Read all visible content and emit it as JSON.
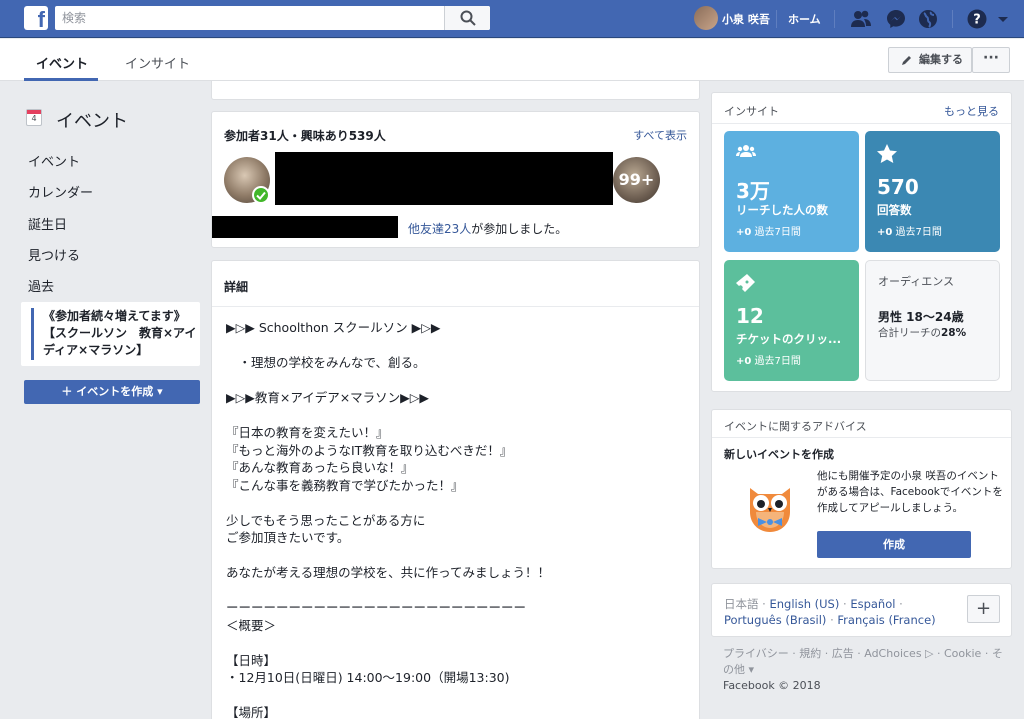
{
  "topbar": {
    "logo": "f",
    "search_placeholder": "検索",
    "user_name": "小泉 咲吾",
    "home": "ホーム",
    "icons": [
      "friends-icon",
      "messenger-icon",
      "globe-icon",
      "help-icon",
      "caret-down-icon"
    ]
  },
  "subnav": {
    "tabs": [
      {
        "label": "イベント",
        "active": true
      },
      {
        "label": "インサイト",
        "active": false
      }
    ],
    "edit_label": "編集する",
    "more_label": "···"
  },
  "left": {
    "calendar_day": "4",
    "title": "イベント",
    "items": [
      "イベント",
      "カレンダー",
      "誕生日",
      "見つける",
      "過去"
    ],
    "promo": "《参加者続々増えてます》【スクールソン　教育×アイディア×マラソン】",
    "create_button": "＋ イベントを作成 ▾"
  },
  "attendance": {
    "title": "参加者31人・興味あり539人",
    "see_all": "すべて表示",
    "more_count": "99+",
    "friends_link": "他友達23人",
    "friends_suffix": "が参加しました。"
  },
  "detail": {
    "title": "詳細",
    "body": "▶▷▶ Schoolthon スクールソン ▶▷▶\n\n　・理想の学校をみんなで、創る。\n\n▶▷▶教育×アイデア×マラソン▶▷▶\n\n『日本の教育を変えたい！』\n『もっと海外のようなIT教育を取り込むべきだ！』\n『あんな教育あったら良いな！』\n『こんな事を義務教育で学びたかった！』\n\n少しでもそう思ったことがある方に\nご参加頂きたいです。\n\nあなたが考える理想の学校を、共に作ってみましょう！！\n\nーーーーーーーーーーーーーーーーーーーーーーーー\n＜概要＞\n\n【日時】\n・12月10日(日曜日) 14:00〜19:00（開場13:30)\n\n【場所】"
  },
  "insights": {
    "header": "インサイト",
    "see_more": "もっと見る",
    "tiles": [
      {
        "value": "3万",
        "label": "リーチした人の数",
        "delta": "+0",
        "period": "過去7日間",
        "color": "#5db0e0"
      },
      {
        "value": "570",
        "label": "回答数",
        "delta": "+0",
        "period": "過去7日間",
        "color": "#3b88b3"
      },
      {
        "value": "12",
        "label": "チケットのクリッ...",
        "delta": "+0",
        "period": "過去7日間",
        "color": "#5cbf9c"
      }
    ],
    "audience": {
      "header": "オーディエンス",
      "value": "男性 18〜24歳",
      "sub_prefix": "合計リーチの",
      "sub_value": "28%"
    }
  },
  "advice": {
    "header": "イベントに関するアドバイス",
    "title": "新しいイベントを作成",
    "text": "他にも開催予定の小泉 咲吾のイベントがある場合は、Facebookでイベントを作成してアピールしましょう。",
    "button": "作成"
  },
  "languages": {
    "current": "日本語",
    "links": [
      "English (US)",
      "Español",
      "Português (Brasil)",
      "Français (France)"
    ],
    "plus": "+"
  },
  "footer": {
    "links": "プライバシー · 規約 · 広告 · AdChoices ▷ · Cookie · その他 ▾",
    "copyright": "Facebook © 2018"
  }
}
